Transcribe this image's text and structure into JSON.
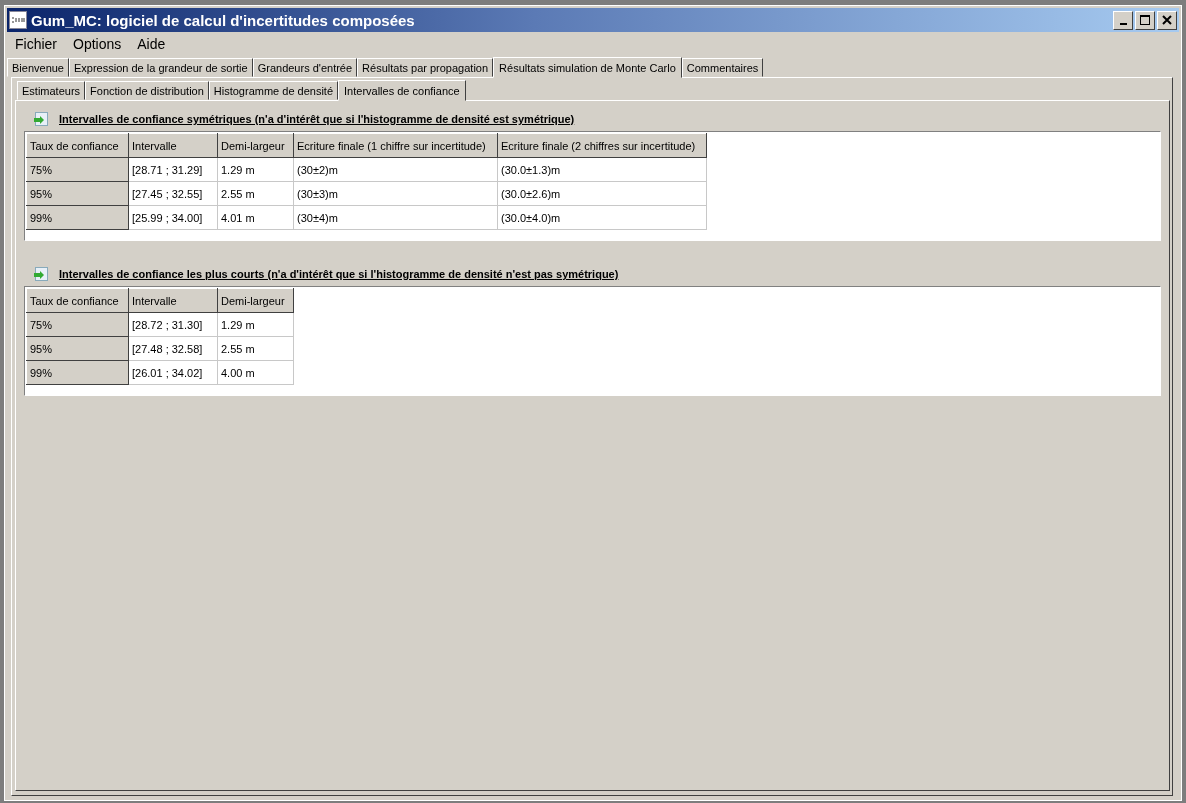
{
  "window": {
    "title": "Gum_MC: logiciel de calcul d'incertitudes composées"
  },
  "menu": [
    "Fichier",
    "Options",
    "Aide"
  ],
  "tabs": [
    {
      "label": "Bienvenue",
      "selected": false
    },
    {
      "label": "Expression de la grandeur de sortie",
      "selected": false
    },
    {
      "label": "Grandeurs d'entrée",
      "selected": false
    },
    {
      "label": "Résultats par propagation",
      "selected": false
    },
    {
      "label": "Résultats simulation de Monte Carlo",
      "selected": true
    },
    {
      "label": "Commentaires",
      "selected": false
    }
  ],
  "subtabs": [
    {
      "label": "Estimateurs",
      "selected": false
    },
    {
      "label": "Fonction de distribution",
      "selected": false
    },
    {
      "label": "Histogramme de densité",
      "selected": false
    },
    {
      "label": "Intervalles de confiance",
      "selected": true
    }
  ],
  "sections": [
    {
      "title": "Intervalles de confiance symétriques (n'a d'intérêt que si l'histogramme de densité est symétrique)",
      "columns": [
        "Taux de confiance",
        "Intervalle",
        "Demi-largeur",
        "Ecriture finale (1 chiffre sur incertitude)",
        "Ecriture finale (2 chiffres sur incertitude)"
      ],
      "rows": [
        [
          "75%",
          "[28.71 ; 31.29]",
          "1.29 m",
          "(30±2)m",
          "(30.0±1.3)m"
        ],
        [
          "95%",
          "[27.45 ; 32.55]",
          "2.55 m",
          "(30±3)m",
          "(30.0±2.6)m"
        ],
        [
          "99%",
          "[25.99 ; 34.00]",
          "4.01 m",
          "(30±4)m",
          "(30.0±4.0)m"
        ]
      ]
    },
    {
      "title": "Intervalles de confiance les plus courts (n'a d'intérêt que si l'histogramme de densité n'est pas symétrique)",
      "columns": [
        "Taux de confiance",
        "Intervalle",
        "Demi-largeur"
      ],
      "rows": [
        [
          "75%",
          "[28.72 ; 31.30]",
          "1.29 m"
        ],
        [
          "95%",
          "[27.48 ; 32.58]",
          "2.55 m"
        ],
        [
          "99%",
          "[26.01 ; 34.02]",
          "4.00 m"
        ]
      ]
    }
  ]
}
